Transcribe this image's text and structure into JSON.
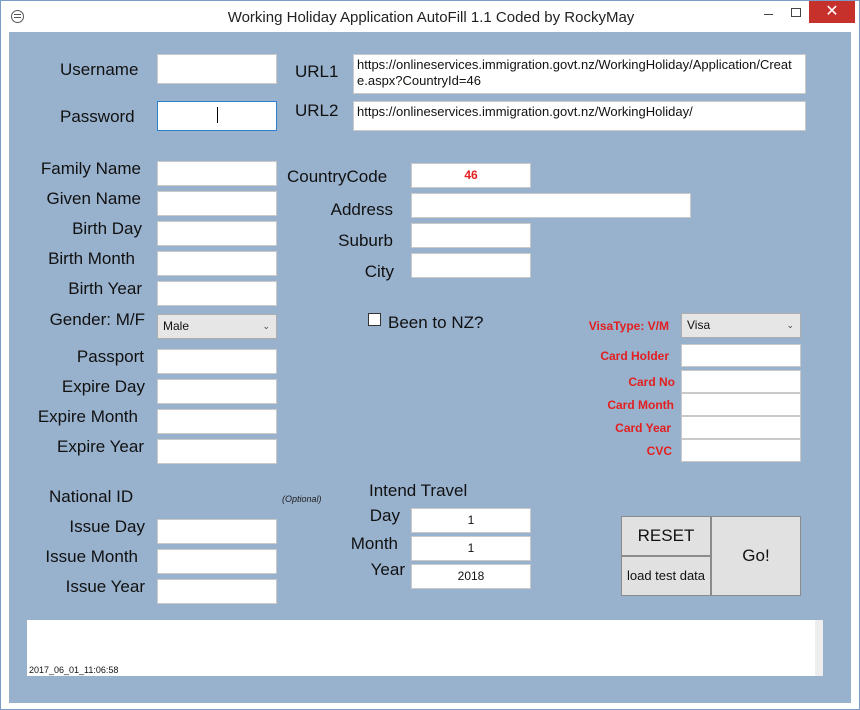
{
  "window": {
    "title": "Working Holiday Application AutoFill 1.1  Coded by RockyMay",
    "close_glyph": "✕"
  },
  "labels": {
    "username": "Username",
    "password": "Password",
    "url1": "URL1",
    "url2": "URL2",
    "family_name": "Family Name",
    "given_name": "Given Name",
    "birth_day": "Birth Day",
    "birth_month": "Birth Month",
    "birth_year": "Birth Year",
    "gender": "Gender: M/F",
    "passport": "Passport",
    "expire_day": "Expire Day",
    "expire_month": "Expire Month",
    "expire_year": "Expire Year",
    "national_id": "National ID",
    "optional": "(Optional)",
    "issue_day": "Issue Day",
    "issue_month": "Issue Month",
    "issue_year": "Issue Year",
    "country_code": "CountryCode",
    "address": "Address",
    "suburb": "Suburb",
    "city": "City",
    "been_to_nz": "Been to NZ?",
    "intend_travel": "Intend Travel",
    "day": "Day",
    "month": "Month",
    "year": "Year",
    "visa_type": "VisaType: V/M",
    "card_holder": "Card Holder",
    "card_no": "Card No",
    "card_month": "Card Month",
    "card_year": "Card Year",
    "cvc": "CVC"
  },
  "fields": {
    "url1": "https://onlineservices.immigration.govt.nz/WorkingHoliday/Application/Create.aspx?CountryId=46",
    "url2": "https://onlineservices.immigration.govt.nz/WorkingHoliday/",
    "country_code": "46",
    "gender": "Male",
    "visa_type": "Visa",
    "travel_day": "1",
    "travel_month": "1",
    "travel_year": "2018"
  },
  "buttons": {
    "reset": "RESET",
    "load_test_data": "load test data",
    "go": "Go!"
  },
  "log": {
    "text": "2017_06_01_11:06:58"
  },
  "colors": {
    "client_bg": "#98b1cd",
    "accent_red": "#e31f1f",
    "close_red": "#c7312b"
  }
}
